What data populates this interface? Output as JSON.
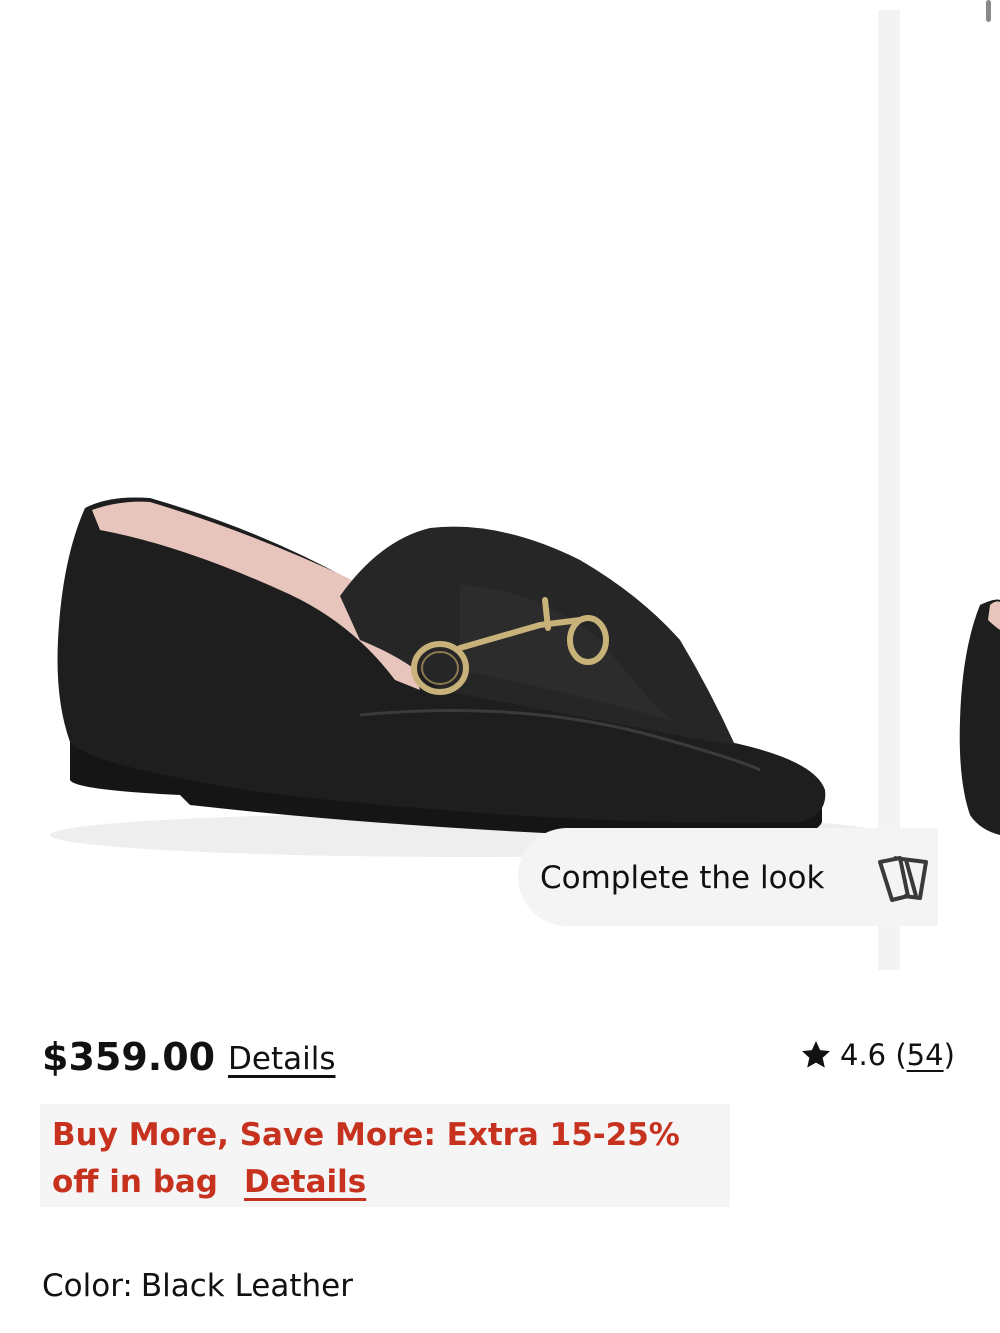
{
  "gallery": {
    "image_alt": "Black leather loafer with gold horsebit hardware",
    "complete_the_look": "Complete the look"
  },
  "product": {
    "price": "$359.00",
    "details_link": "Details",
    "rating": {
      "score": "4.6",
      "count": "54"
    }
  },
  "promo": {
    "text": "Buy More, Save More: Extra 15-25% off in bag",
    "details_link": "Details"
  },
  "color": {
    "label": "Color:",
    "value": "Black Leather"
  },
  "colors": {
    "promo_red": "#c7321f",
    "text": "#111111",
    "pill_bg": "#f4f4f4"
  }
}
